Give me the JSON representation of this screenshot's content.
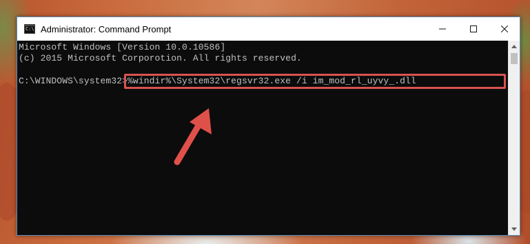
{
  "window": {
    "title": "Administrator: Command Prompt",
    "icon_glyph": "C:\\",
    "controls": {
      "minimize_icon": "minimize-icon",
      "maximize_icon": "maximize-icon",
      "close_icon": "close-icon"
    }
  },
  "console": {
    "lines": [
      "Microsoft Windows [Version 10.0.10586]",
      "(c) 2015 Microsoft Corporotion. All rights reserved.",
      ""
    ],
    "prompt": "C:\\WINDOWS\\system32>",
    "command": "%windir%\\System32\\regsvr32.exe /i im_mod_rl_uyvy_.dll"
  },
  "annotation": {
    "highlight_color": "#d9534f",
    "arrow_color": "#e0504a"
  },
  "colors": {
    "console_bg": "#0c0c0c",
    "console_text": "#c0c0c0"
  }
}
